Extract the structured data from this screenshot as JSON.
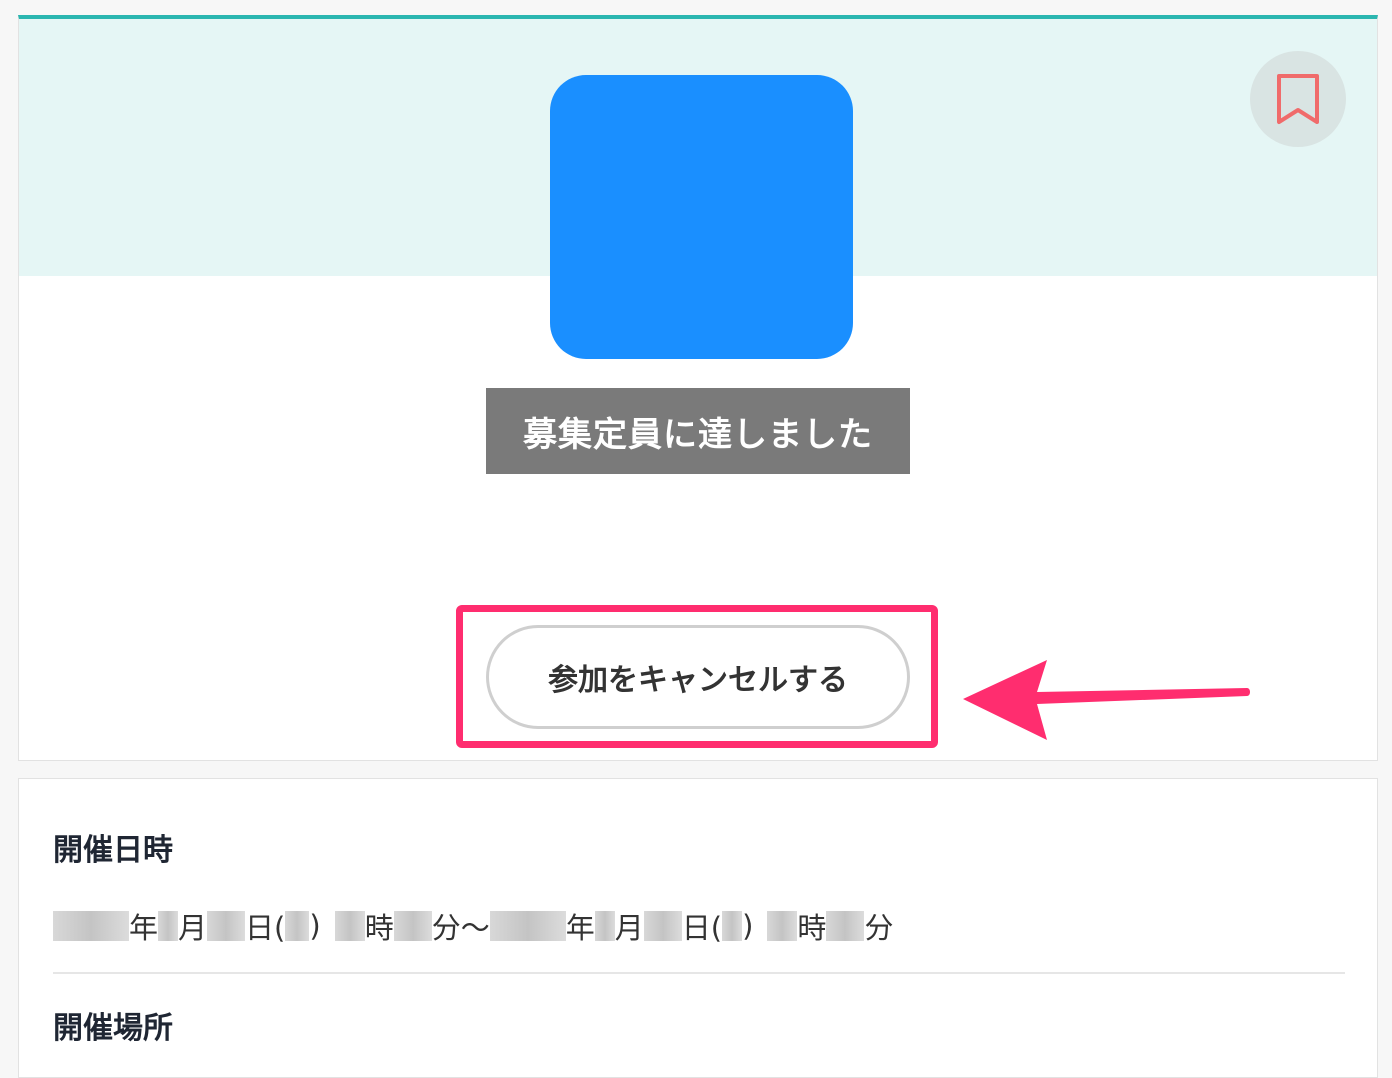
{
  "event": {
    "status": "募集定員に達しました",
    "cancel_label": "参加をキャンセルする"
  },
  "info": {
    "date_heading": "開催日時",
    "date_text": {
      "year": "年",
      "month": "月",
      "day": "日(",
      "close_paren": ")",
      "hour": "時",
      "minute": "分",
      "tilde": "〜"
    },
    "venue_heading": "開催場所"
  },
  "colors": {
    "accent": "#2bb6b0",
    "logo": "#1a8fff",
    "highlight": "#ff2d6f",
    "bookmark": "#f06b6b"
  },
  "icons": {
    "bookmark": "bookmark-icon",
    "arrow": "arrow-left-icon"
  }
}
